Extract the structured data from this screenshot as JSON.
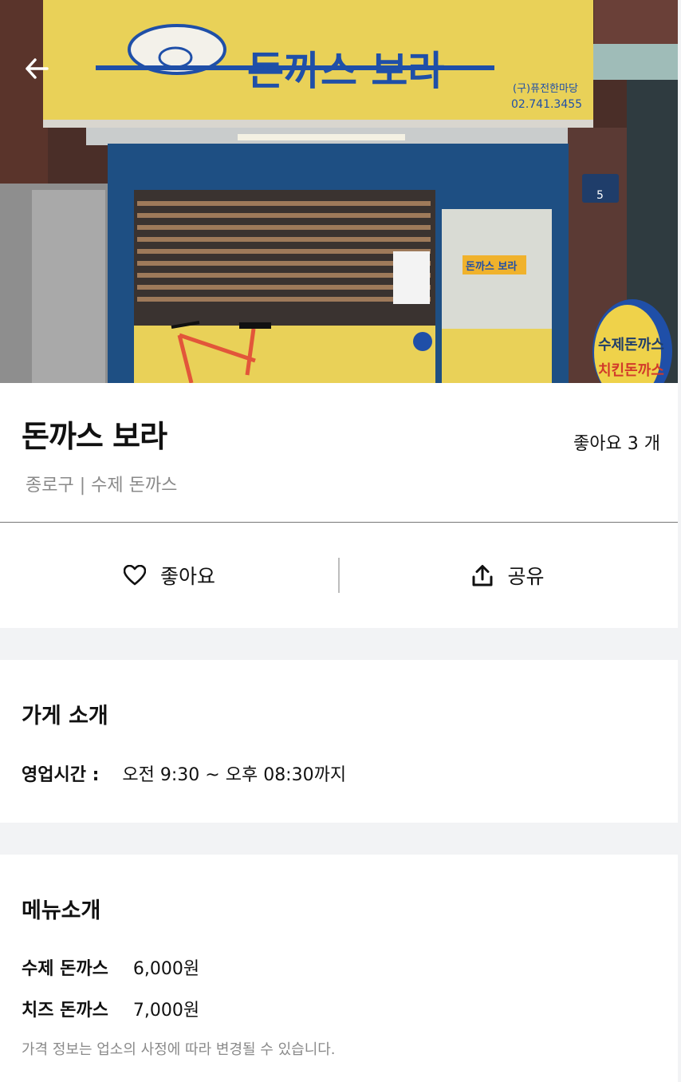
{
  "hero": {
    "sign_text": "돈까스 보라",
    "sign_sub1": "(구)퓨전한마당",
    "sign_sub2": "02.741.3455",
    "window_sign": "돈까스 보라",
    "address_sign": "5",
    "side_sign_line1": "수제돈까스",
    "side_sign_line2": "치킨돈까스"
  },
  "store": {
    "name": "돈까스 보라",
    "likes": "좋아요 3 개",
    "subtitle": "종로구 | 수제 돈까스"
  },
  "actions": {
    "like_label": "좋아요",
    "share_label": "공유"
  },
  "intro": {
    "title": "가게 소개",
    "hours_label": "영업시간 :",
    "hours_value": "오전 9:30 ~ 오후 08:30까지"
  },
  "menu": {
    "title": "메뉴소개",
    "items": [
      {
        "name": "수제 돈까스",
        "price": "6,000원"
      },
      {
        "name": "치즈 돈까스",
        "price": "7,000원"
      }
    ],
    "note": "가격 정보는 업소의 사정에 따라 변경될 수 있습니다."
  },
  "colors": {
    "sign_yellow": "#e9d158",
    "sign_blue": "#1f4fa8",
    "storefront_blue": "#1e4f83",
    "band_gray": "#f2f3f5",
    "muted_text": "#8a8a8a"
  }
}
